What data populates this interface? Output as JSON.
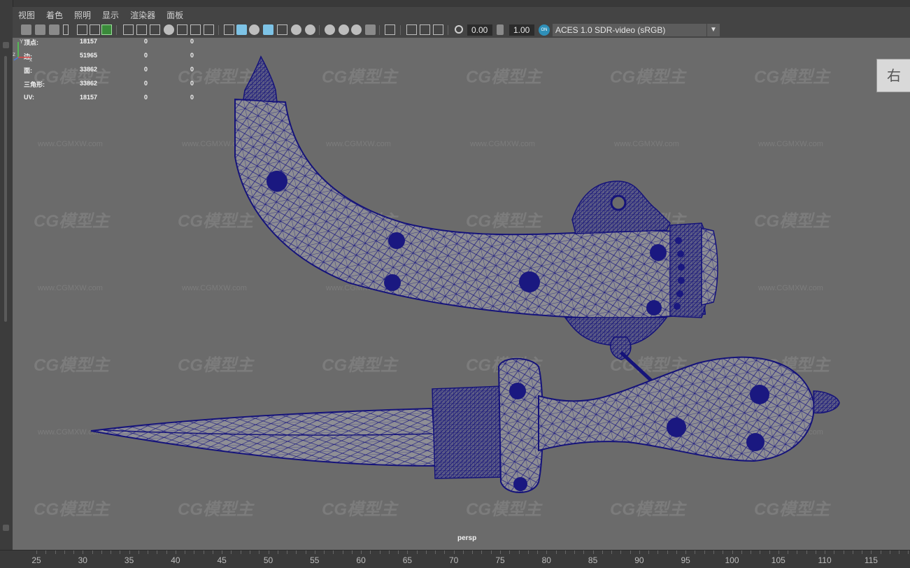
{
  "menu": [
    "视图",
    "着色",
    "照明",
    "显示",
    "渲染器",
    "面板"
  ],
  "toolbar": {
    "exposure_value": "0.00",
    "gamma_value": "1.00",
    "color_space": "ACES 1.0 SDR-video (sRGB)",
    "on_icon": "ON"
  },
  "stats": {
    "rows": [
      {
        "label": "顶点:",
        "a": "18157",
        "b": "0",
        "c": "0"
      },
      {
        "label": "边:",
        "a": "51965",
        "b": "0",
        "c": "0"
      },
      {
        "label": "面:",
        "a": "33862",
        "b": "0",
        "c": "0"
      },
      {
        "label": "三角形:",
        "a": "33862",
        "b": "0",
        "c": "0"
      },
      {
        "label": "UV:",
        "a": "18157",
        "b": "0",
        "c": "0"
      }
    ]
  },
  "viewport": {
    "camera": "persp",
    "viewcube_label": "右",
    "watermark_logo": "CG模型主",
    "watermark_url": "www.CGMXW.com",
    "axis_x": "x",
    "axis_y": "Y",
    "axis_z": "z"
  },
  "timeline": {
    "ticks": [
      "25",
      "30",
      "35",
      "40",
      "45",
      "50",
      "55",
      "60",
      "65",
      "70",
      "75",
      "80",
      "85",
      "90",
      "95",
      "100",
      "105",
      "110",
      "115"
    ]
  },
  "colors": {
    "viewport_bg": "#6b6b6b",
    "wire": "#14127a",
    "mesh_fill": "#8d8d93",
    "accent_active": "#7dc3e6"
  }
}
